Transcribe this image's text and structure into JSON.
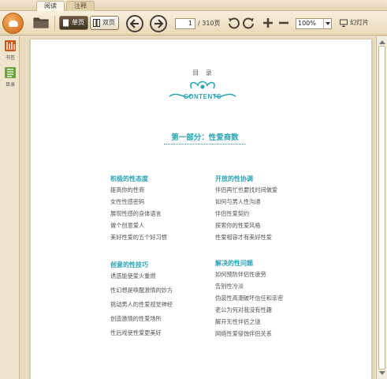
{
  "tabs": [
    {
      "label": "阅读",
      "active": true
    },
    {
      "label": "注释",
      "active": false
    }
  ],
  "toolbar": {
    "single_page": "单页",
    "double_page": "双页",
    "current_page": "1",
    "total_pages": "/ 310页",
    "zoom": "100%",
    "slideshow": "幻灯片"
  },
  "sidebar": {
    "items": [
      {
        "label": "书签",
        "icon": "bookmark-icon"
      },
      {
        "label": "目录",
        "icon": "toc-icon"
      }
    ]
  },
  "document": {
    "toc_label": "目 录",
    "contents_logo": "CONTENTS",
    "part_title": "第一部分：性爱商数",
    "sections": [
      {
        "heading": "积极的性态度",
        "items": [
          "提高你的性商",
          "女性性感密码",
          "展现性感的身体语言",
          "做个创意爱人",
          "美好性爱的五个好习惯"
        ]
      },
      {
        "heading": "开放的性协调",
        "items": [
          "伴侣再忙也要找时间做爱",
          "如何与男人性沟通",
          "伴侣性爱契约",
          "探索你的性爱风格",
          "性爱相容才有美好性爱"
        ]
      },
      {
        "heading": "创意的性技巧",
        "items": [
          "诱惑能使爱火重燃",
          "性幻想是唤醒激情的妙方",
          "挑动男人的性爱视觉神经",
          "创造激情的性爱场所",
          "性后戏使性爱更美好"
        ]
      },
      {
        "heading": "解决的性问题",
        "items": [
          "如何预防伴侣性疲劳",
          "告别性冷淡",
          "伪装性高潮破坏信任和亲密",
          "老公为何对我没有性趣",
          "解开无性伴侣之谜",
          "网络性爱侵蚀伴侣关系"
        ]
      }
    ]
  },
  "colors": {
    "accent": "#2aa3b6",
    "toolbar_bg": "#f3e8d1",
    "logo_orange": "#e28a3a"
  }
}
